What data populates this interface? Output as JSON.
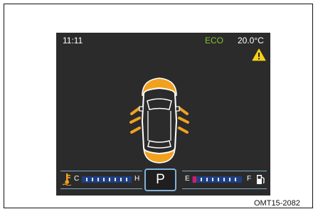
{
  "status": {
    "time": "11:11",
    "eco": "ECO",
    "temperature": "20.0°C"
  },
  "icons": {
    "warning": "warning-triangle-icon",
    "coolant": "coolant-temperature-icon",
    "fuel": "fuel-pump-icon",
    "car": "car-top-view-icon"
  },
  "gauges": {
    "coolant": {
      "low_label": "C",
      "high_label": "H"
    },
    "fuel": {
      "low_label": "E",
      "high_label": "F",
      "level_marker_color": "#d81b60"
    }
  },
  "gear": "P",
  "caption": "OMT15-2082",
  "colors": {
    "screen_bg": "#2b2b2b",
    "eco": "#86c232",
    "accent_orange": "#f0a21f",
    "warning_yellow": "#f3d21b",
    "gauge_blue": "#1d3f86",
    "frame_blue": "#7fb2da"
  }
}
